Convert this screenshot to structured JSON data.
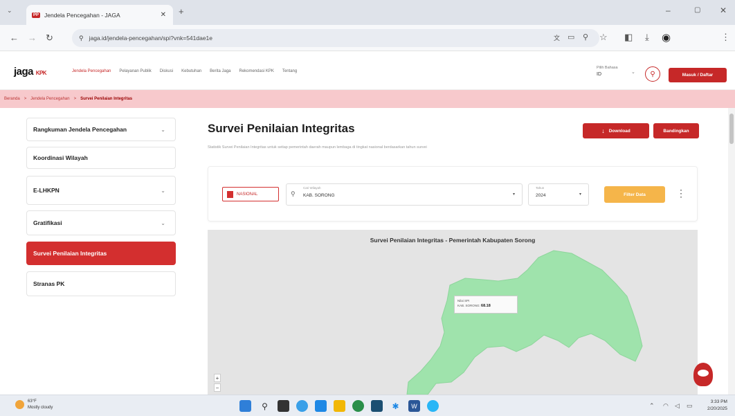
{
  "browser": {
    "tab_title": "Jendela Pencegahan - JAGA",
    "tab_favicon_text": "PP",
    "url": "jaga.id/jendela-pencegahan/spi?vnk=541dae1e",
    "new_tab": "+"
  },
  "site": {
    "logo": "jaga",
    "logo_mark": "KPK",
    "nav": [
      "Jendela Pencegahan",
      "Pelayanan Publik",
      "Diskusi",
      "Kebutuhan",
      "Berita Jaga",
      "Rekomendasi KPK",
      "Tentang"
    ],
    "region_label": "Pilih Bahasa",
    "region_value": "ID",
    "login_button": "Masuk / Daftar"
  },
  "breadcrumb": {
    "items": [
      "Beranda",
      "Jendela Pencegahan",
      "Survei Penilaian Integritas"
    ],
    "separator": ">"
  },
  "sidebar": {
    "items": [
      {
        "label": "Rangkuman Jendela Pencegahan",
        "chev": "⌄"
      },
      {
        "label": "Koordinasi Wilayah",
        "chev": ""
      },
      {
        "label": "E-LHKPN",
        "chev": "⌄"
      },
      {
        "label": "Gratifikasi",
        "chev": "⌄"
      },
      {
        "label": "Survei Penilaian Integritas",
        "chev": ""
      },
      {
        "label": "Stranas PK",
        "chev": ""
      }
    ]
  },
  "main": {
    "title": "Survei Penilaian Integritas",
    "subtitle": "Statistik Survei Penilaian Integritas untuk setiap pemerintah daerah maupun lembaga di tingkat nasional berdasarkan tahun survei",
    "download_button": "Download",
    "compare_button": "Bandingkan",
    "download_icon": "↓"
  },
  "filters": {
    "scope_button": "NASIONAL",
    "region_label": "Cari Wilayah",
    "region_value": "KAB. SORONG",
    "year_label": "Tahun",
    "year_value": "2024",
    "apply_button": "Filter Data",
    "more_icon": "⋮"
  },
  "map": {
    "title": "Survei Penilaian Integritas - Pemerintah Kabupaten Sorong",
    "fill_color": "#9fe3ac",
    "tooltip_header": "Nilai SPI",
    "tooltip_region": "KAB. SORONG",
    "tooltip_value": "68.18",
    "zoom_in": "+",
    "zoom_out": "−"
  },
  "taskbar": {
    "weather_temp": "63°F",
    "weather_desc": "Mostly cloudy",
    "time": "3:33 PM",
    "date": "2/20/2025"
  }
}
